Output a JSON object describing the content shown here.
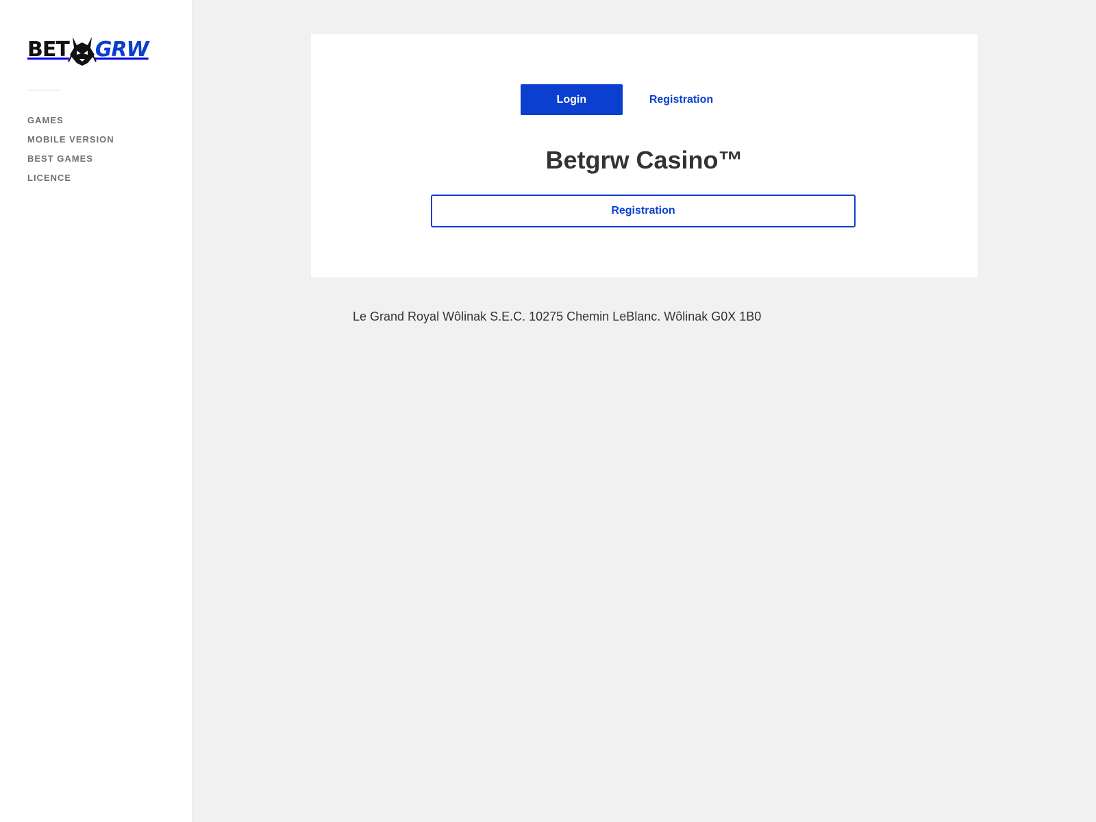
{
  "brand": {
    "logo_part1": "BET",
    "logo_part2": "GRW",
    "accent_color": "#0a3fd0",
    "mascot_icon": "lynx-head-icon"
  },
  "sidebar": {
    "nav": [
      {
        "label": "GAMES"
      },
      {
        "label": "MOBILE VERSION"
      },
      {
        "label": "BEST GAMES"
      },
      {
        "label": "LICENCE"
      }
    ]
  },
  "card": {
    "tabs": {
      "login_label": "Login",
      "registration_label": "Registration"
    },
    "title": "Betgrw Casino™",
    "registration_button_label": "Registration"
  },
  "footer": {
    "address": "Le Grand Royal Wôlinak S.E.C. 10275 Chemin LeBlanc. Wôlinak G0X 1B0"
  }
}
